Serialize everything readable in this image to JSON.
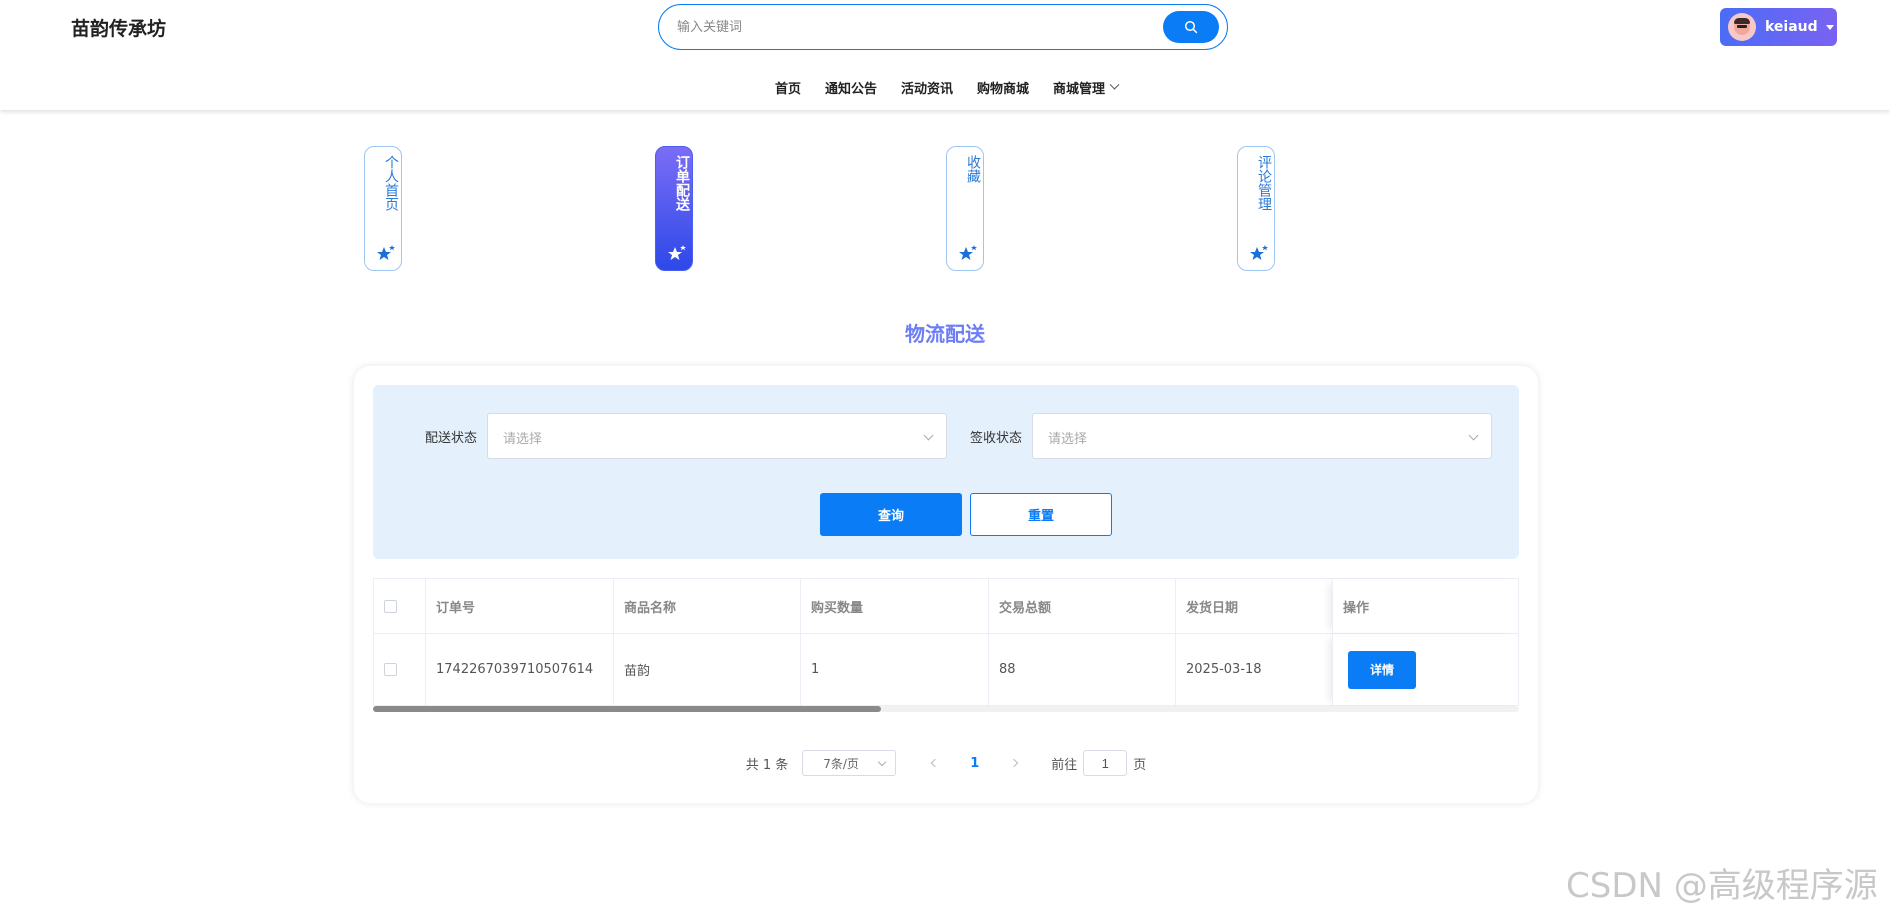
{
  "header": {
    "site_title": "苗韵传承坊",
    "search_placeholder": "输入关键词",
    "username": "keiaud"
  },
  "nav": [
    {
      "label": "首页"
    },
    {
      "label": "通知公告"
    },
    {
      "label": "活动资讯"
    },
    {
      "label": "购物商城"
    },
    {
      "label": "商城管理",
      "has_dropdown": true
    }
  ],
  "side_tabs": [
    {
      "label": "个人首页",
      "active": false
    },
    {
      "label": "订单配送",
      "active": true
    },
    {
      "label": "收藏",
      "active": false
    },
    {
      "label": "评论管理",
      "active": false
    }
  ],
  "section_title": "物流配送",
  "filters": {
    "delivery_label": "配送状态",
    "delivery_placeholder": "请选择",
    "receipt_label": "签收状态",
    "receipt_placeholder": "请选择",
    "query_label": "查询",
    "reset_label": "重置"
  },
  "table": {
    "columns": [
      "订单号",
      "商品名称",
      "购买数量",
      "交易总额",
      "发货日期",
      "操作"
    ],
    "rows": [
      {
        "order_no": "1742267039710507614",
        "product": "苗韵",
        "quantity": "1",
        "total": "88",
        "ship_date": "2025-03-18",
        "action": "详情"
      }
    ]
  },
  "pagination": {
    "total_text": "共 1 条",
    "page_size": "7条/页",
    "current_page": "1",
    "goto_prefix": "前往",
    "goto_value": "1",
    "goto_suffix": "页"
  },
  "watermark": "CSDN @高级程序源",
  "colors": {
    "primary": "#0a7cf6",
    "panel": "#e4f0fc",
    "title_accent": "#6c7df5"
  },
  "icons": [
    "search-icon",
    "star-icon",
    "caret-down-icon",
    "chevron-left-icon",
    "chevron-right-icon"
  ]
}
